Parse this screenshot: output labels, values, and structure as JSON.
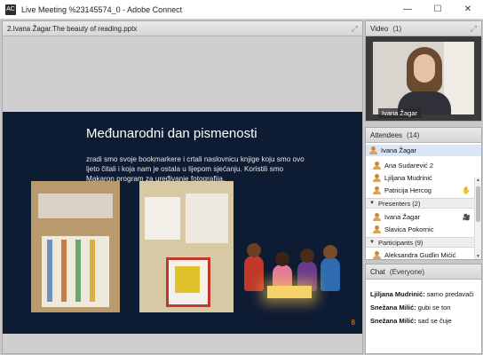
{
  "window": {
    "title": "Live Meeting %23145574_0 - Adobe Connect",
    "app_icon": "AC",
    "minimize": "—",
    "maximize": "☐",
    "close": "✕"
  },
  "share_pod": {
    "title": "2.Ivana Žagar.The beauty of reading.pptx",
    "slide": {
      "heading": "Međunarodni dan pismenosti",
      "body": "zradi smo svoje bookmarkere i crtali naslovnicu knjige koju smo ovo ljeto čitali i koja nam je ostala u lijepom sjećanju. Koristili smo Makaron program za uređivanje fotografija.",
      "page_number": "8"
    }
  },
  "video_pod": {
    "title": "Video",
    "count": "(1)",
    "camera_label": "Ivana Žagar"
  },
  "attendees_pod": {
    "title": "Attendees",
    "count": "(14)",
    "self": "Ivana Žagar",
    "hosts": [
      "Ana Sudarević 2",
      "Ljiljana Mudrinić",
      "Patricija Hercog"
    ],
    "presenters_group": "Presenters (2)",
    "presenters": [
      "Ivana Žagar",
      "Slavica Pokornic"
    ],
    "participants_group": "Participants (9)",
    "participants": [
      "Aleksandra Gudlin Mićić"
    ]
  },
  "chat_pod": {
    "title": "Chat",
    "scope": "(Everyone)",
    "messages": [
      {
        "who": "Ljiljana Mudrinić:",
        "text": "samo predavači"
      },
      {
        "who": "Snežana Milić:",
        "text": "gubi se ton"
      },
      {
        "who": "Snežana Milić:",
        "text": "sad se čuje"
      }
    ]
  }
}
